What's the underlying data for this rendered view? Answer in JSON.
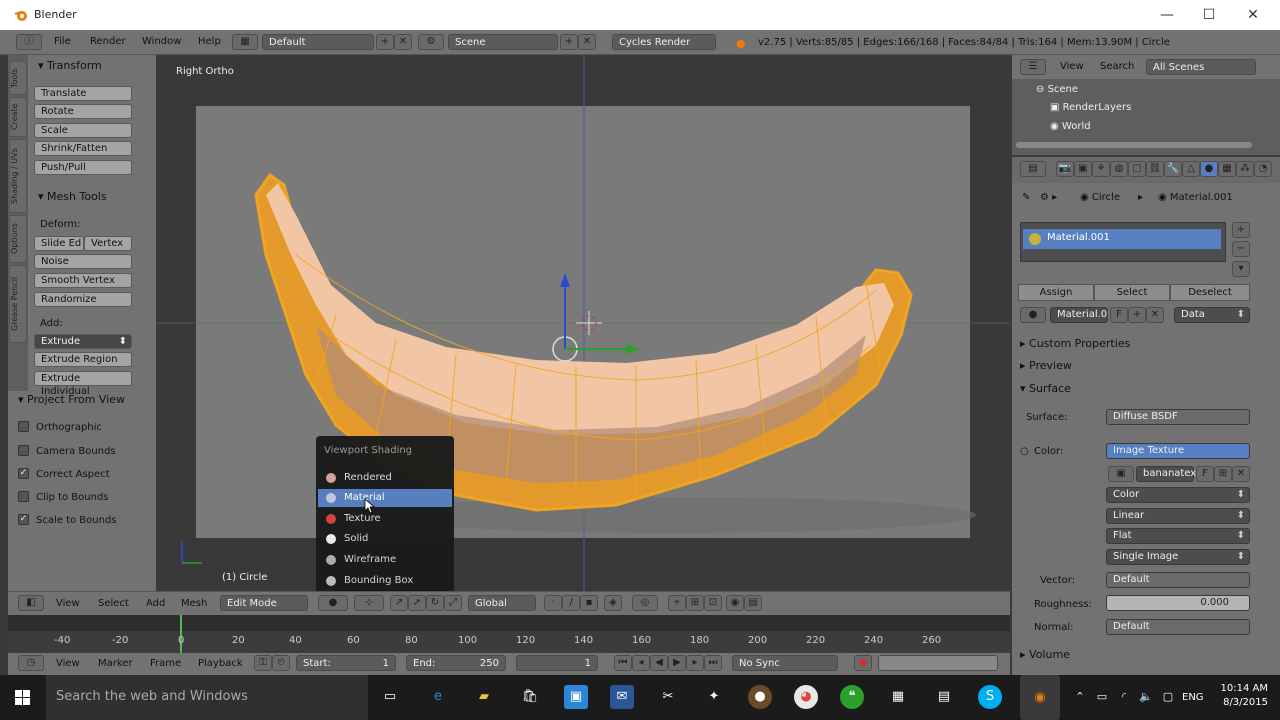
{
  "window": {
    "title": "Blender",
    "min": "—",
    "max": "☐",
    "close": "✕"
  },
  "infobar": {
    "menus": [
      "File",
      "Render",
      "Window",
      "Help"
    ],
    "screen_layout": "Default",
    "scene": "Scene",
    "render_engine": "Cycles Render",
    "stats": "v2.75 | Verts:85/85 | Edges:166/168 | Faces:84/84 | Tris:164 | Mem:13.90M | Circle"
  },
  "toolshelf": {
    "tabs": [
      "Tools",
      "Create",
      "Shading / UVs",
      "Options",
      "Grease Pencil"
    ],
    "transform": {
      "header": "Transform",
      "buttons": [
        "Translate",
        "Rotate",
        "Scale",
        "Shrink/Fatten",
        "Push/Pull"
      ]
    },
    "mesh_tools": {
      "header": "Mesh Tools",
      "deform_label": "Deform:",
      "slide_edge": "Slide Ed",
      "vertex": "Vertex",
      "noise": "Noise",
      "smooth_vertex": "Smooth Vertex",
      "randomize": "Randomize",
      "add_label": "Add:",
      "extrude": "Extrude",
      "extrude_region": "Extrude Region",
      "extrude_individual": "Extrude Individual"
    },
    "project": {
      "header": "Project From View",
      "options": [
        {
          "label": "Orthographic",
          "checked": false
        },
        {
          "label": "Camera Bounds",
          "checked": false
        },
        {
          "label": "Correct Aspect",
          "checked": true
        },
        {
          "label": "Clip to Bounds",
          "checked": false
        },
        {
          "label": "Scale to Bounds",
          "checked": true
        }
      ]
    }
  },
  "viewport": {
    "view_label": "Right Ortho",
    "object_label": "(1) Circle",
    "shading_menu": {
      "title": "Viewport Shading",
      "items": [
        {
          "label": "Rendered",
          "color": "#d9a0a0",
          "selected": false
        },
        {
          "label": "Material",
          "color": "#c9c9e0",
          "selected": true
        },
        {
          "label": "Texture",
          "color": "#d94040",
          "selected": false
        },
        {
          "label": "Solid",
          "color": "#f0f0f0",
          "selected": false
        },
        {
          "label": "Wireframe",
          "color": "#b0b0b0",
          "selected": false
        },
        {
          "label": "Bounding Box",
          "color": "#c0c0c0",
          "selected": false
        }
      ]
    }
  },
  "vp_header": {
    "menus": [
      "View",
      "Select",
      "Add",
      "Mesh"
    ],
    "mode": "Edit Mode",
    "orientation": "Global"
  },
  "timeline": {
    "ticks": [
      "-40",
      "-20",
      "0",
      "20",
      "40",
      "60",
      "80",
      "100",
      "120",
      "140",
      "160",
      "180",
      "200",
      "220",
      "240",
      "260"
    ],
    "menus": [
      "View",
      "Marker",
      "Frame",
      "Playback"
    ],
    "start_label": "Start:",
    "start_value": "1",
    "end_label": "End:",
    "end_value": "250",
    "current_frame": "1",
    "sync": "No Sync"
  },
  "outliner": {
    "menus": [
      "View",
      "Search"
    ],
    "filter": "All Scenes",
    "items": [
      "Scene",
      "RenderLayers",
      "World"
    ]
  },
  "properties": {
    "breadcrumb_object": "Circle",
    "breadcrumb_material": "Material.001",
    "material_slot": "Material.001",
    "assign": "Assign",
    "select": "Select",
    "deselect": "Deselect",
    "material_name": "Material.0",
    "material_f": "F",
    "link": "Data",
    "sections": {
      "custom_properties": "Custom Properties",
      "preview": "Preview",
      "surface": "Surface",
      "volume": "Volume"
    },
    "surface_label": "Surface:",
    "surface_value": "Diffuse BSDF",
    "color_label": "Color:",
    "color_value": "Image Texture",
    "image_name": "bananatex",
    "image_f": "F",
    "color_space": "Color",
    "interpolation": "Linear",
    "projection": "Flat",
    "source": "Single Image",
    "vector_label": "Vector:",
    "vector_value": "Default",
    "roughness_label": "Roughness:",
    "roughness_value": "0.000",
    "normal_label": "Normal:",
    "normal_value": "Default"
  },
  "taskbar": {
    "search_placeholder": "Search the web and Windows",
    "lang": "ENG",
    "time": "10:14 AM",
    "date": "8/3/2015"
  }
}
